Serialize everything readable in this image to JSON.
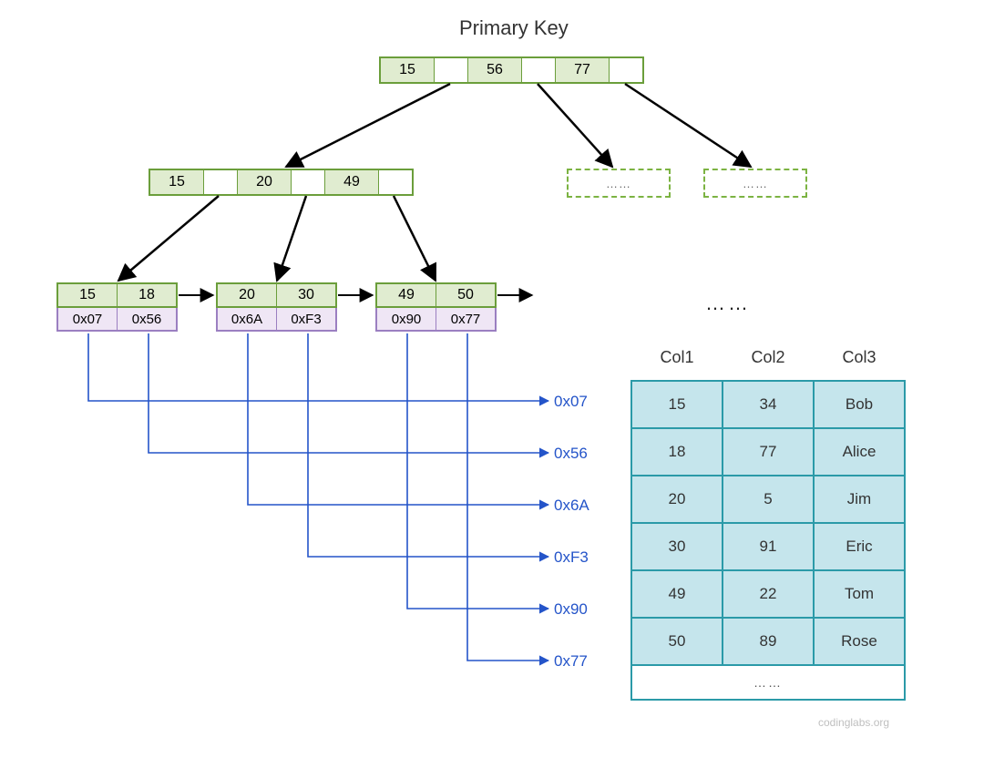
{
  "title": "Primary Key",
  "root": {
    "keys": [
      "15",
      "56",
      "77"
    ]
  },
  "internal": {
    "keys": [
      "15",
      "20",
      "49"
    ]
  },
  "placeholders": [
    "……",
    "……"
  ],
  "leaves": [
    {
      "keys": [
        "15",
        "18"
      ],
      "addrs": [
        "0x07",
        "0x56"
      ]
    },
    {
      "keys": [
        "20",
        "30"
      ],
      "addrs": [
        "0x6A",
        "0xF3"
      ]
    },
    {
      "keys": [
        "49",
        "50"
      ],
      "addrs": [
        "0x90",
        "0x77"
      ]
    }
  ],
  "ellipsis": "……",
  "address_labels": [
    "0x07",
    "0x56",
    "0x6A",
    "0xF3",
    "0x90",
    "0x77"
  ],
  "table": {
    "headers": [
      "Col1",
      "Col2",
      "Col3"
    ],
    "rows": [
      [
        "15",
        "34",
        "Bob"
      ],
      [
        "18",
        "77",
        "Alice"
      ],
      [
        "20",
        "5",
        "Jim"
      ],
      [
        "30",
        "91",
        "Eric"
      ],
      [
        "49",
        "22",
        "Tom"
      ],
      [
        "50",
        "89",
        "Rose"
      ]
    ],
    "footer": "……"
  },
  "watermark": "codinglabs.org"
}
